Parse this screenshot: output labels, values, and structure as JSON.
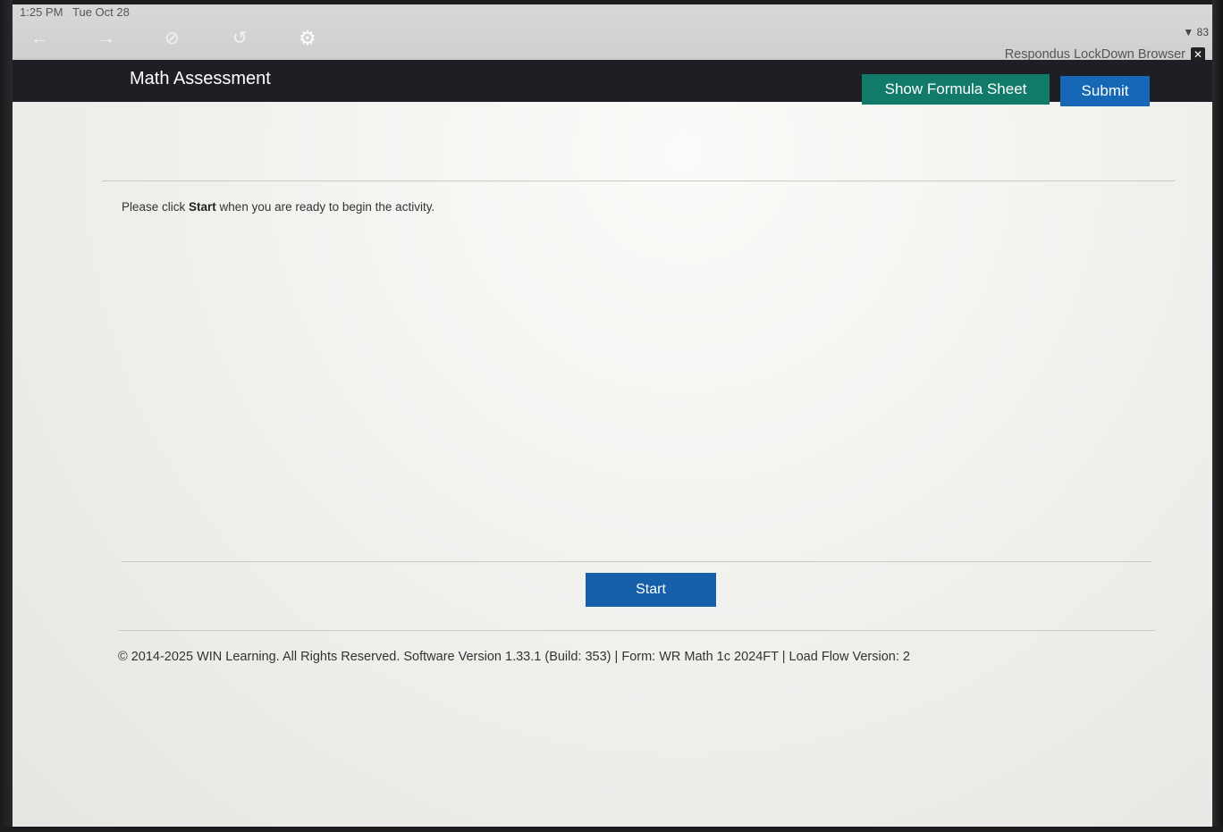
{
  "status_bar": {
    "time": "1:25 PM",
    "date": "Tue Oct 28",
    "battery_text": "83"
  },
  "browser_toolbar": {
    "icons": [
      "back-arrow-icon",
      "forward-arrow-icon",
      "stop-icon",
      "reload-icon",
      "settings-gear-icon"
    ],
    "branding": "Respondus LockDown Browser"
  },
  "header": {
    "title": "Math Assessment",
    "formula_button_label": "Show Formula Sheet",
    "submit_button_label": "Submit"
  },
  "main": {
    "instruction_before": "Please click ",
    "instruction_bold": "Start",
    "instruction_after": " when you are ready to begin the activity.",
    "start_button_label": "Start"
  },
  "footer": {
    "text": "© 2014-2025 WIN Learning. All Rights Reserved. Software Version 1.33.1 (Build: 353) | Form: WR Math 1c 2024FT | Load Flow Version: 2"
  },
  "colors": {
    "header_bg": "#1e1f24",
    "formula_button": "#117a68",
    "submit_button": "#1668b7",
    "start_button": "#1560a8"
  }
}
